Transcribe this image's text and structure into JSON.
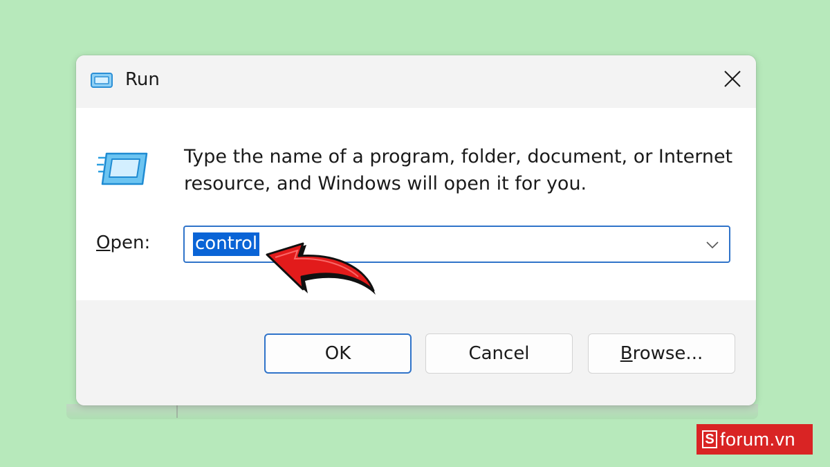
{
  "window": {
    "title": "Run",
    "close_icon": "close-icon",
    "app_icon": "run-icon"
  },
  "content": {
    "description": "Type the name of a program, folder, document, or Internet resource, and Windows will open it for you.",
    "open_label_mnemonic": "O",
    "open_label_rest": "pen:",
    "open_value": "control",
    "dropdown_icon": "chevron-down-icon",
    "selection_color": "#0a64d6",
    "focus_border_color": "#2f73c9"
  },
  "buttons": {
    "ok": "OK",
    "cancel": "Cancel",
    "browse_mnemonic": "B",
    "browse_rest": "rowse..."
  },
  "annotation": {
    "arrow_icon": "red-pointer-arrow",
    "arrow_color": "#e21b1b"
  },
  "watermark": {
    "logo_letter": "S",
    "text": "forum.vn",
    "color": "#d92424"
  },
  "background_color": "#b7e9bb"
}
